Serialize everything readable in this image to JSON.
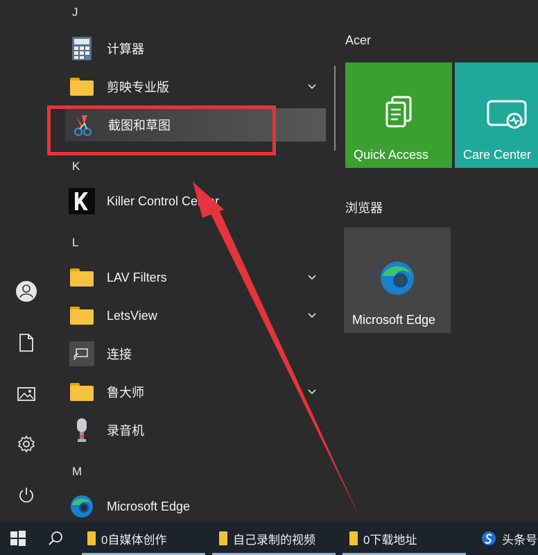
{
  "sidebar": {
    "items": [
      {
        "name": "user-account",
        "icon": "user-icon"
      },
      {
        "name": "documents",
        "icon": "document-icon"
      },
      {
        "name": "pictures",
        "icon": "picture-icon"
      },
      {
        "name": "settings",
        "icon": "gear-icon"
      },
      {
        "name": "power",
        "icon": "power-icon"
      }
    ]
  },
  "applist": {
    "letters": {
      "j": "J",
      "k": "K",
      "l": "L",
      "m": "M"
    },
    "apps": [
      {
        "label": "计算器",
        "icon": "calculator-icon",
        "expandable": false
      },
      {
        "label": "剪映专业版",
        "icon": "folder-icon",
        "expandable": true
      },
      {
        "label": "截图和草图",
        "icon": "snip-sketch-icon",
        "expandable": false,
        "highlighted": true
      },
      {
        "label": "Killer Control Center",
        "icon": "killer-icon",
        "expandable": false
      },
      {
        "label": "LAV Filters",
        "icon": "folder-icon",
        "expandable": true
      },
      {
        "label": "LetsView",
        "icon": "folder-icon",
        "expandable": true
      },
      {
        "label": "连接",
        "icon": "connect-icon",
        "expandable": false
      },
      {
        "label": "鲁大师",
        "icon": "folder-icon",
        "expandable": true
      },
      {
        "label": "录音机",
        "icon": "recorder-icon",
        "expandable": false
      },
      {
        "label": "Microsoft Edge",
        "icon": "edge-icon",
        "expandable": false
      }
    ]
  },
  "tiles": {
    "groups": [
      {
        "title": "Acer",
        "tiles": [
          {
            "label": "Quick Access",
            "color": "#3aa02f",
            "icon": "quick-access-icon"
          },
          {
            "label": "Care Center",
            "color": "#1fa99a",
            "icon": "care-center-icon"
          }
        ]
      },
      {
        "title": "浏览器",
        "tiles": [
          {
            "label": "Microsoft Edge",
            "color": "#454545",
            "icon": "edge-icon"
          }
        ]
      }
    ]
  },
  "taskbar": {
    "items": [
      {
        "label": "0自媒体创作",
        "icon": "folder-icon"
      },
      {
        "label": "自己录制的视频",
        "icon": "folder-icon"
      },
      {
        "label": "0下载地址",
        "icon": "folder-icon"
      },
      {
        "label": "头条号",
        "icon": "sogou-icon"
      }
    ]
  },
  "colors": {
    "background": "#2b2b2b",
    "taskbar": "#1d232b",
    "annotation": "#e5343a",
    "folder": "#f6c341"
  }
}
